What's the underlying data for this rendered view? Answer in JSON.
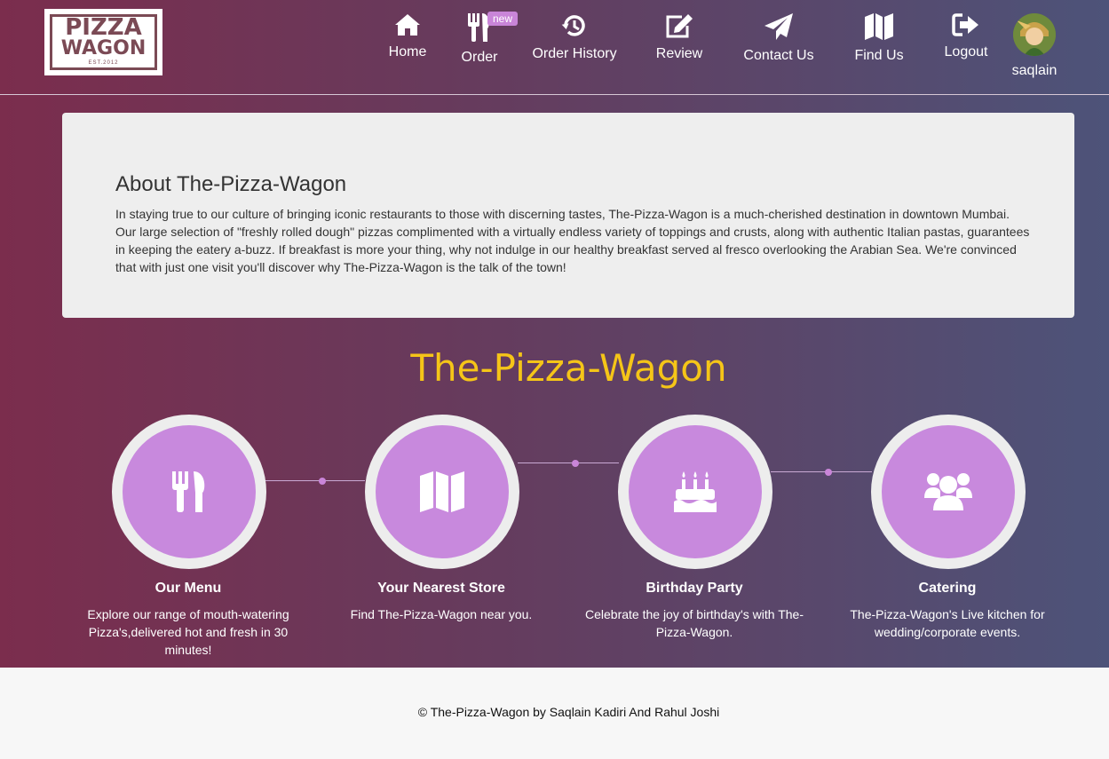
{
  "header": {
    "logo": {
      "line1": "PIZZA",
      "line2": "WAGON",
      "line3": "EST.2012"
    },
    "nav": [
      {
        "label": "Home",
        "icon": "home-icon"
      },
      {
        "label": "Order",
        "icon": "utensils-icon",
        "badge": "new"
      },
      {
        "label": "Order History",
        "icon": "history-icon"
      },
      {
        "label": "Review",
        "icon": "edit-icon"
      },
      {
        "label": "Contact Us",
        "icon": "paper-plane-icon"
      },
      {
        "label": "Find Us",
        "icon": "map-icon"
      },
      {
        "label": "Logout",
        "icon": "logout-icon"
      }
    ],
    "user": {
      "name": "saqlain"
    }
  },
  "about": {
    "title": "About The-Pizza-Wagon",
    "text": "In staying true to our culture of bringing iconic restaurants to those with discerning tastes, The-Pizza-Wagon is a much-cherished destination in downtown Mumbai. Our large selection of \"freshly rolled dough\" pizzas complimented with a virtually endless variety of toppings and crusts, along with authentic Italian pastas, guarantees in keeping the eatery a-buzz. If breakfast is more your thing, why not indulge in our healthy breakfast served al fresco overlooking the Arabian Sea. We're convinced that with just one visit you'll discover why The-Pizza-Wagon is the talk of the town!"
  },
  "brand_title": "The-Pizza-Wagon",
  "features": [
    {
      "title": "Our Menu",
      "desc": "Explore our range of mouth-watering Pizza's,delivered hot and fresh in 30 minutes!",
      "icon": "utensils-icon"
    },
    {
      "title": "Your Nearest Store",
      "desc": "Find The-Pizza-Wagon near you.",
      "icon": "map-icon"
    },
    {
      "title": "Birthday Party",
      "desc": "Celebrate the joy of birthday's with The-Pizza-Wagon.",
      "icon": "birthday-cake-icon"
    },
    {
      "title": "Catering",
      "desc": "The-Pizza-Wagon's Live kitchen for wedding/corporate events.",
      "icon": "users-icon"
    }
  ],
  "footer": {
    "text": "© The-Pizza-Wagon by Saqlain Kadiri And Rahul Joshi"
  },
  "colors": {
    "accent": "#c889dd",
    "brand_text": "#f5c518",
    "gradient_left": "#7b2d4d",
    "gradient_right": "#4d5379"
  }
}
